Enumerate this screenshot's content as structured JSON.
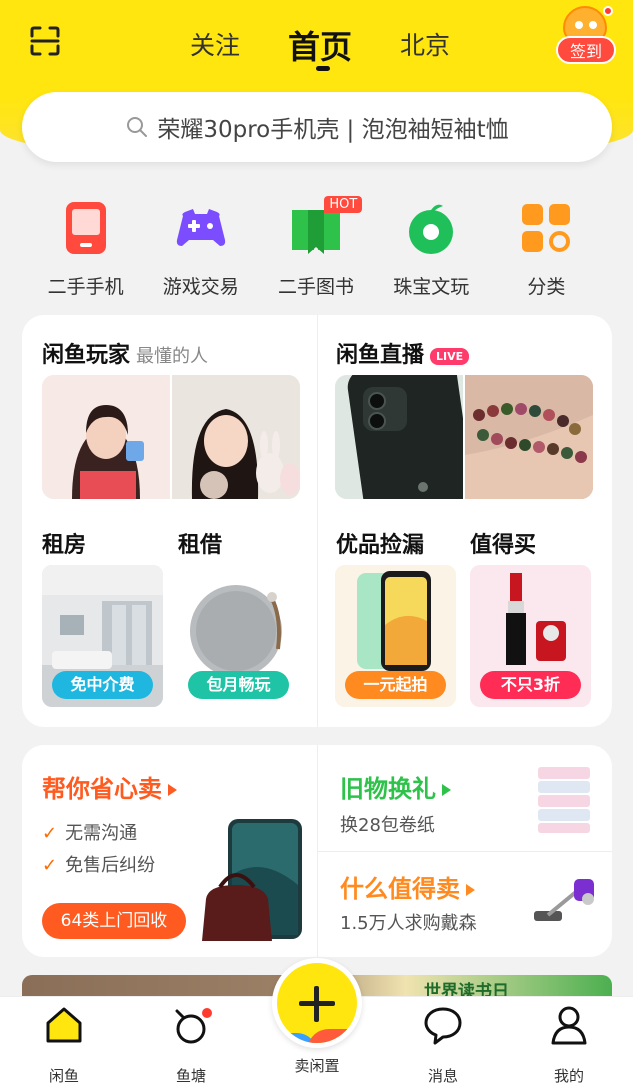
{
  "header": {
    "tabs": [
      {
        "label": "关注"
      },
      {
        "label": "首页"
      },
      {
        "label": "北京"
      }
    ],
    "signin_label": "签到",
    "scan_icon": "scan-icon"
  },
  "search": {
    "placeholder": "荣耀30pro手机壳 | 泡泡袖短袖t恤"
  },
  "categories": [
    {
      "label": "二手手机",
      "icon": "phone-icon",
      "color": "#ff4a3d"
    },
    {
      "label": "游戏交易",
      "icon": "gamepad-icon",
      "color": "#7b4dff"
    },
    {
      "label": "二手图书",
      "icon": "book-icon",
      "color": "#2ec24a",
      "badge": "HOT"
    },
    {
      "label": "珠宝文玩",
      "icon": "jewel-icon",
      "color": "#1fbf5a"
    },
    {
      "label": "分类",
      "icon": "category-grid-icon",
      "color": "#ff9a1f"
    }
  ],
  "feature": {
    "players": {
      "title": "闲鱼玩家",
      "subtitle": "最懂的人"
    },
    "live": {
      "title": "闲鱼直播",
      "badge": "LIVE"
    },
    "rent_house": {
      "title": "租房",
      "tag": "免中介费"
    },
    "rent_borrow": {
      "title": "租借",
      "tag": "包月畅玩"
    },
    "bargain": {
      "title": "优品捡漏",
      "tag": "一元起拍"
    },
    "worth_buy": {
      "title": "值得买",
      "tag": "不只3折"
    }
  },
  "promo": {
    "sell": {
      "title": "帮你省心卖",
      "points": [
        "无需沟通",
        "免售后纠纷"
      ],
      "cta": "64类上门回收"
    },
    "exchange": {
      "title": "旧物换礼",
      "subtitle": "换28包卷纸"
    },
    "worth_sell": {
      "title": "什么值得卖",
      "subtitle": "1.5万人求购戴森"
    }
  },
  "banner": {
    "text": "世界读书日"
  },
  "nav": {
    "items": [
      {
        "label": "闲鱼"
      },
      {
        "label": "鱼塘"
      },
      {
        "label": "卖闲置"
      },
      {
        "label": "消息"
      },
      {
        "label": "我的"
      }
    ]
  },
  "colors": {
    "brand_yellow": "#ffe60f",
    "accent_red": "#ff4a3d",
    "promo_orange": "#ff5a1f",
    "green": "#2ec24a"
  }
}
